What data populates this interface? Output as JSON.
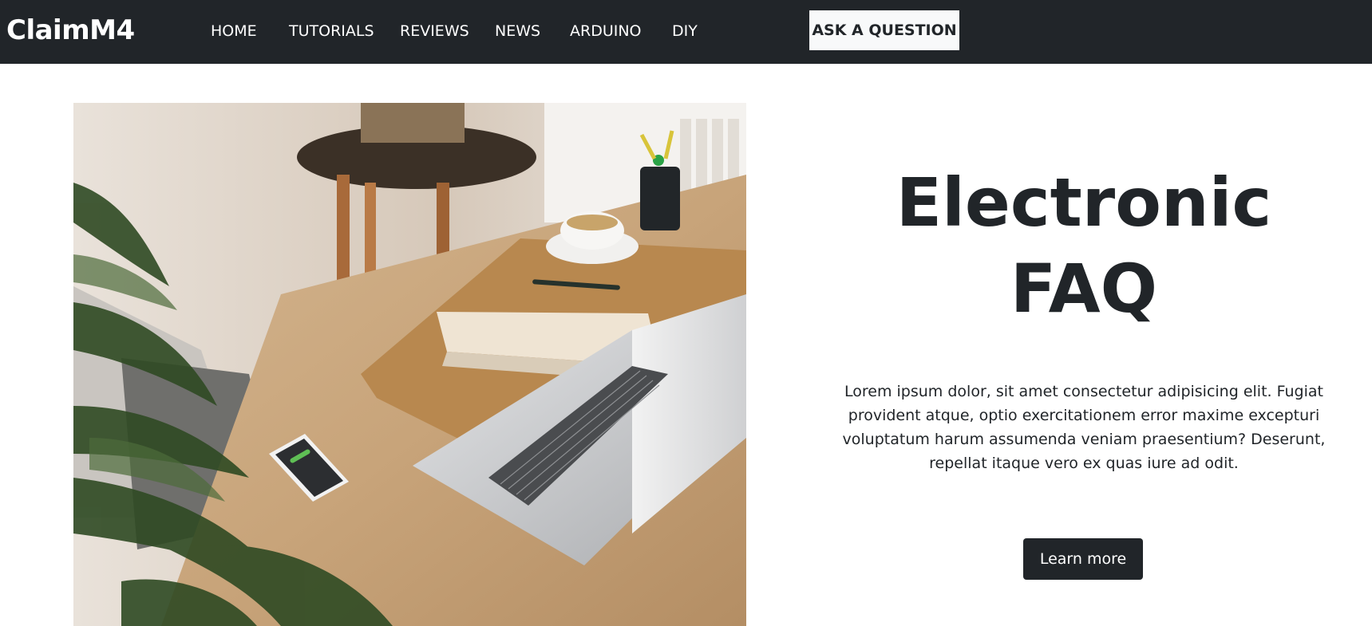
{
  "brand": "ClaimM4",
  "nav": {
    "items": [
      {
        "label": "HOME"
      },
      {
        "label": "TUTORIALS"
      },
      {
        "label": "REVIEWS"
      },
      {
        "label": "NEWS"
      },
      {
        "label": "ARDUINO"
      },
      {
        "label": "DIY"
      }
    ],
    "cta_label": "ASK A QUESTION"
  },
  "hero": {
    "image_icon": "desk-laptop-photo",
    "title_line1": "Electronic",
    "title_line2": "FAQ",
    "description": "Lorem ipsum dolor, sit amet consectetur adipisicing elit. Fugiat provident atque, optio exercitationem error maxime excepturi voluptatum harum assumenda veniam praesentium? Deserunt, repellat itaque vero ex quas iure ad odit.",
    "button_label": "Learn more"
  },
  "colors": {
    "navbar_bg": "#212529",
    "nav_text": "#ffffff",
    "cta_bg": "#f8f9fa",
    "primary_button_bg": "#212529",
    "body_text": "#212529"
  }
}
